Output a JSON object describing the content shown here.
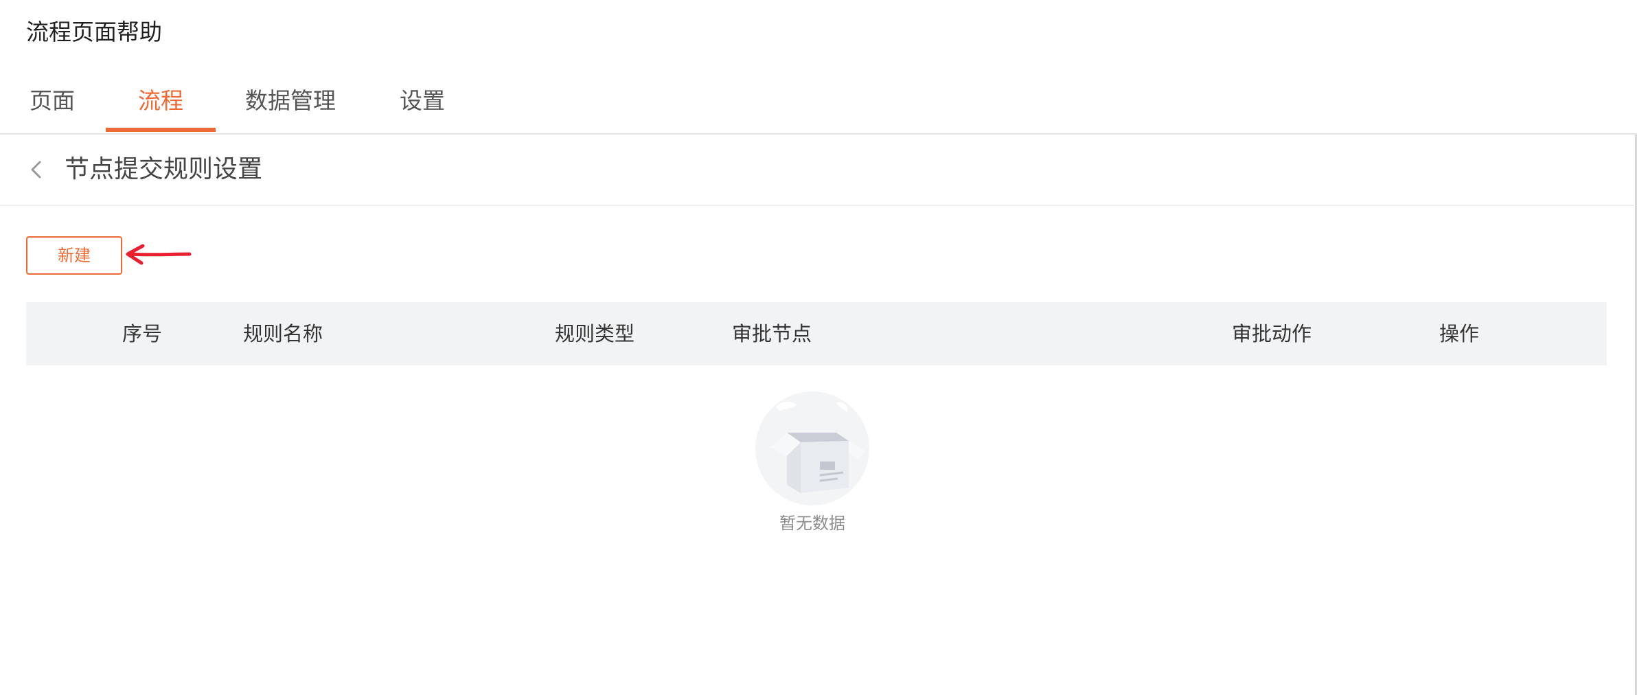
{
  "app": {
    "title": "流程页面帮助"
  },
  "tabs": [
    {
      "label": "页面",
      "active": false
    },
    {
      "label": "流程",
      "active": true
    },
    {
      "label": "数据管理",
      "active": false
    },
    {
      "label": "设置",
      "active": false
    }
  ],
  "subheader": {
    "back_icon": "chevron-left-icon",
    "title": "节点提交规则设置"
  },
  "toolbar": {
    "new_label": "新建"
  },
  "table": {
    "columns": [
      "序号",
      "规则名称",
      "规则类型",
      "审批节点",
      "审批动作",
      "操作"
    ],
    "rows": []
  },
  "empty_state": {
    "icon": "empty-box-icon",
    "text": "暂无数据"
  },
  "colors": {
    "accent": "#ee6a35",
    "annotation": "#e8202f",
    "header_bg": "#f2f3f5"
  }
}
